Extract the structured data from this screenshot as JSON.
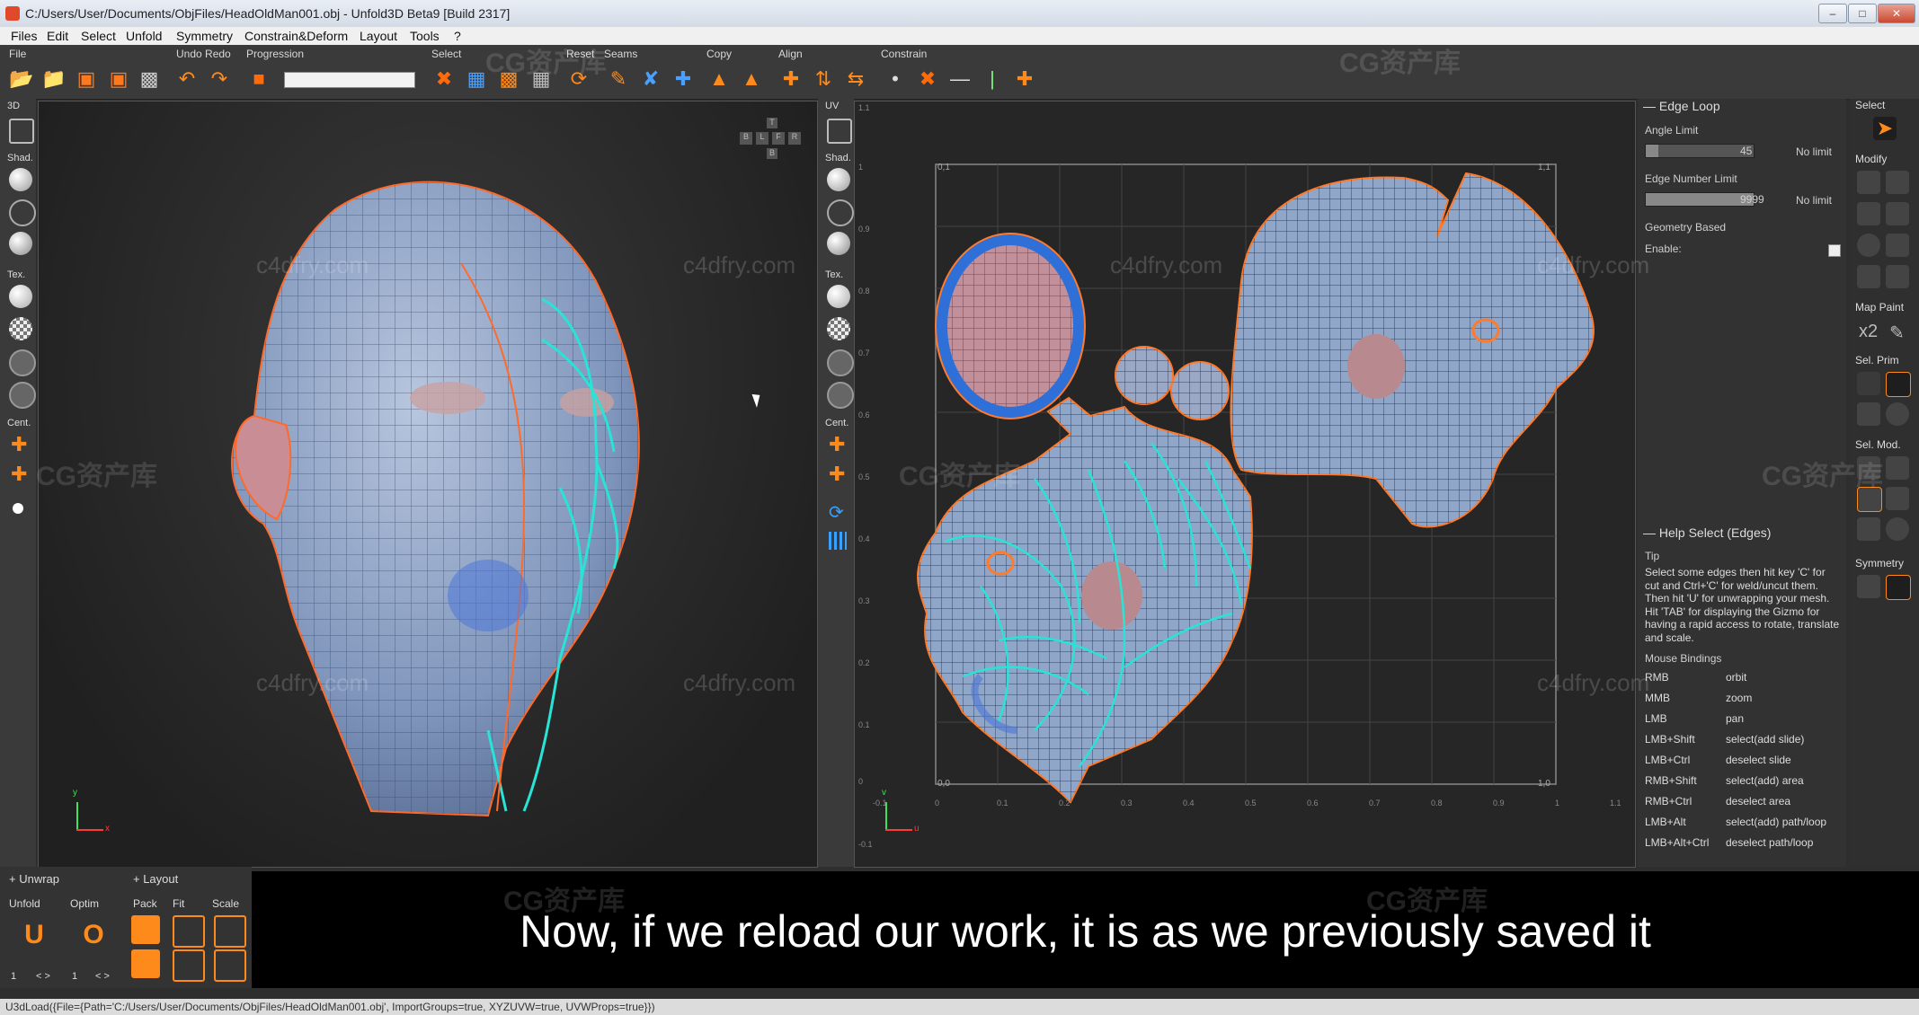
{
  "window": {
    "title": "C:/Users/User/Documents/ObjFiles/HeadOldMan001.obj - Unfold3D Beta9 [Build 2317]",
    "controls": [
      "–",
      "□",
      "✕"
    ]
  },
  "menu": [
    "Files",
    "Edit",
    "Select",
    "Unfold",
    "Symmetry",
    "Constrain&Deform",
    "Layout",
    "Tools",
    "?"
  ],
  "toolbar": {
    "groups": [
      "File",
      "Undo Redo",
      "Progression",
      "Select",
      "Reset",
      "Seams",
      "Copy",
      "Align",
      "Constrain"
    ]
  },
  "left_bar": {
    "labels": [
      "3D",
      "Shad.",
      "Tex.",
      "Cent."
    ]
  },
  "uv_bar": {
    "labels": [
      "UV",
      "Shad.",
      "Tex.",
      "Cent."
    ]
  },
  "viewcube": {
    "top": "T",
    "bottom": "B",
    "mid": [
      "B",
      "L",
      "F",
      "R"
    ]
  },
  "uv_view": {
    "corner_labels": [
      "0,1",
      "1,1",
      "0,0",
      "1,0"
    ],
    "x_ticks": [
      "-0.1",
      "0",
      "0.1",
      "0.2",
      "0.3",
      "0.4",
      "0.5",
      "0.6",
      "0.7",
      "0.8",
      "0.9",
      "1",
      "1.1"
    ],
    "y_ticks": [
      "1.1",
      "1",
      "0.9",
      "0.8",
      "0.7",
      "0.6",
      "0.5",
      "0.4",
      "0.3",
      "0.2",
      "0.1",
      "0",
      "-0.1"
    ],
    "axis_u": "u",
    "axis_v": "v"
  },
  "axis3d": {
    "x": "x",
    "y": "y"
  },
  "edge_loop": {
    "title": "Edge Loop",
    "angle_label": "Angle Limit",
    "angle_value": "45",
    "angle_nolimit": "No limit",
    "angle_fraction": 0.12,
    "edge_label": "Edge Number Limit",
    "edge_value": "9999",
    "edge_nolimit": "No limit",
    "edge_fraction": 1.0,
    "geo_label": "Geometry Based",
    "enable_label": "Enable:"
  },
  "help": {
    "title": "Help Select (Edges)",
    "tip_label": "Tip",
    "tip_text": "Select some edges then hit key 'C' for cut and Ctrl+'C' for weld/uncut them. Then hit 'U' for unwrapping your mesh. Hit 'TAB' for displaying the Gizmo for having a rapid access to rotate, translate and scale.",
    "bindings_label": "Mouse Bindings",
    "bindings": [
      {
        "key": "RMB",
        "action": "orbit"
      },
      {
        "key": "MMB",
        "action": "zoom"
      },
      {
        "key": "LMB",
        "action": "pan"
      },
      {
        "key": "LMB+Shift",
        "action": "select(add slide)"
      },
      {
        "key": "LMB+Ctrl",
        "action": "deselect slide"
      },
      {
        "key": "RMB+Shift",
        "action": "select(add) area"
      },
      {
        "key": "RMB+Ctrl",
        "action": "deselect area"
      },
      {
        "key": "LMB+Alt",
        "action": "select(add) path/loop"
      },
      {
        "key": "LMB+Alt+Ctrl",
        "action": "deselect path/loop"
      }
    ]
  },
  "far_right": {
    "labels": [
      "Select",
      "Modify",
      "Map Paint",
      "Sel. Prim",
      "Sel. Mod.",
      "Symmetry"
    ],
    "x2": "x2"
  },
  "bottom": {
    "unwrap": "+ Unwrap",
    "layout": "+ Layout",
    "unfold": "Unfold",
    "optim": "Optim",
    "pack": "Pack",
    "fit": "Fit",
    "scale": "Scale",
    "unfold_val": "1",
    "optim_val": "1",
    "arrows": "< >"
  },
  "subtitle": "Now, if we reload our work, it is as we previously saved it",
  "status": "U3dLoad({File={Path='C:/Users/User/Documents/ObjFiles/HeadOldMan001.obj', ImportGroups=true, XYZUVW=true, UVWProps=true}})",
  "watermarks": {
    "cg": "CG资产库",
    "c4d": "c4dfry.com"
  },
  "colors": {
    "accent": "#ff8a1c",
    "seam": "#28e3d6",
    "mesh": "#8fa6c8",
    "uv_border": "#ff7a2a"
  }
}
